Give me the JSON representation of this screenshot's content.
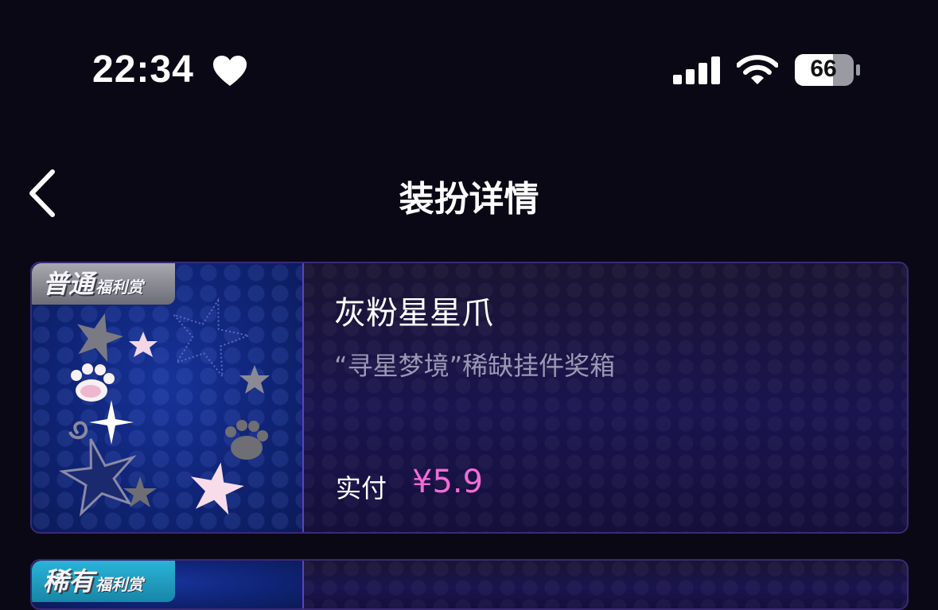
{
  "status_bar": {
    "time": "22:34",
    "battery": "66",
    "icons": [
      "heart-icon",
      "signal-icon",
      "wifi-icon",
      "battery-icon"
    ]
  },
  "nav": {
    "title": "装扮详情",
    "back_icon": "chevron-left-icon"
  },
  "items": [
    {
      "badge_main": "普通",
      "badge_sub": "福利赏",
      "name": "灰粉星星爪",
      "description": "“寻星梦境”稀缺挂件奖箱",
      "pay_label": "实付",
      "price": "¥5.9"
    },
    {
      "badge_main": "稀有",
      "badge_sub": "福利赏"
    }
  ],
  "colors": {
    "background": "#0b0816",
    "price": "#f26bd6",
    "card_border": "#3a2a78",
    "badge_common": "#8a8a94",
    "badge_rare": "#2ab4d8"
  }
}
